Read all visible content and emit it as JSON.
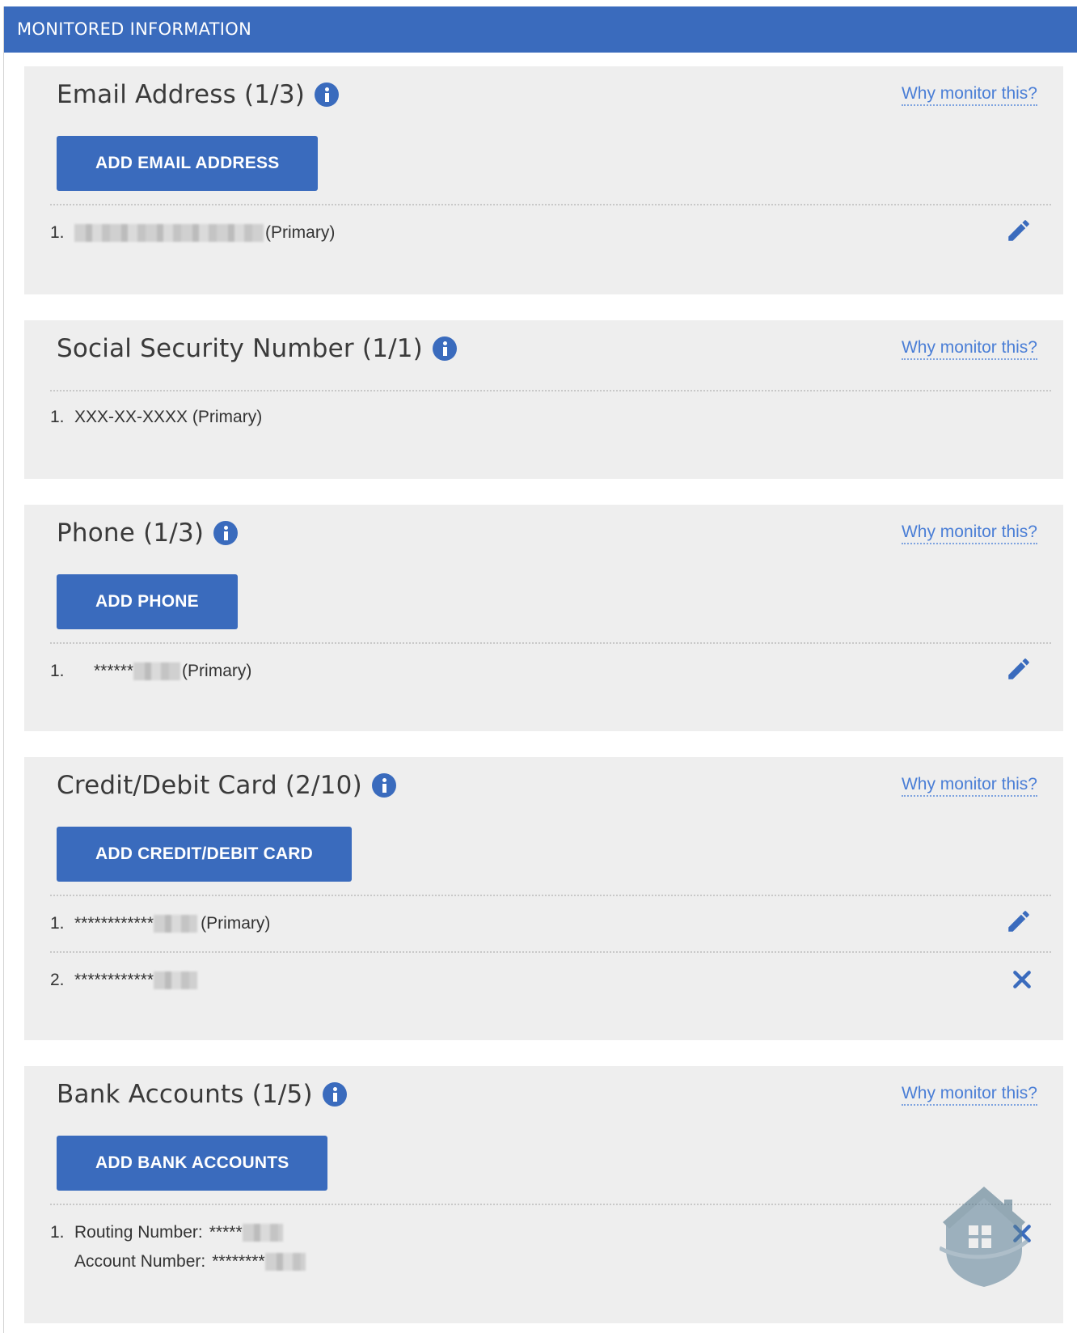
{
  "header": {
    "title": "MONITORED INFORMATION"
  },
  "sections": {
    "email": {
      "title": "Email Address (1/3)",
      "why_link": "Why monitor this?",
      "add_label": "ADD EMAIL ADDRESS",
      "items": [
        {
          "num": "1.",
          "suffix": "(Primary)"
        }
      ]
    },
    "ssn": {
      "title": "Social Security Number (1/1)",
      "why_link": "Why monitor this?",
      "items": [
        {
          "num": "1.",
          "text": "XXX-XX-XXXX (Primary)"
        }
      ]
    },
    "phone": {
      "title": "Phone (1/3)",
      "why_link": "Why monitor this?",
      "add_label": "ADD PHONE",
      "items": [
        {
          "num": "1.",
          "mask": "******",
          "suffix": "(Primary)"
        }
      ]
    },
    "card": {
      "title": "Credit/Debit Card (2/10)",
      "why_link": "Why monitor this?",
      "add_label": "ADD CREDIT/DEBIT CARD",
      "items": [
        {
          "num": "1.",
          "mask": "************",
          "suffix": "(Primary)"
        },
        {
          "num": "2.",
          "mask": "************"
        }
      ]
    },
    "bank": {
      "title": "Bank Accounts (1/5)",
      "why_link": "Why monitor this?",
      "add_label": "ADD BANK ACCOUNTS",
      "items": [
        {
          "num": "1.",
          "routing_label": "Routing Number:",
          "routing_mask": "*****",
          "account_label": "Account Number:",
          "account_mask": "********"
        }
      ]
    }
  },
  "colors": {
    "accent": "#3a6bbd",
    "link": "#4a7ed6",
    "panel": "#eeeeee"
  },
  "icons": {
    "info": "info-icon",
    "edit": "pencil-icon",
    "remove": "close-icon",
    "watermark": "house-shield-icon"
  }
}
